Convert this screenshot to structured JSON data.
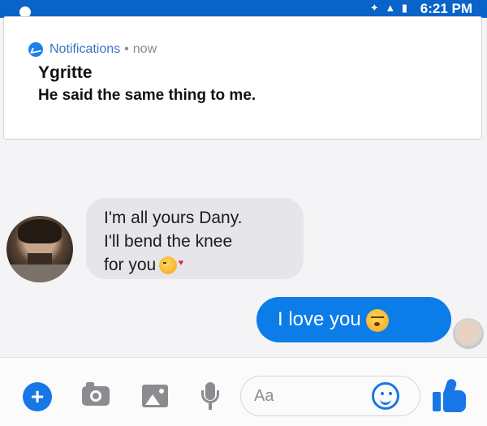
{
  "status_bar": {
    "system_icons": "✦ ▲ ▮",
    "time": "6:21 PM"
  },
  "notification": {
    "app_name": "Notifications",
    "separator": "•",
    "time": "now",
    "sender": "Ygritte",
    "message": "He said the same thing to me."
  },
  "conversation": {
    "incoming": {
      "lines": [
        "I'm all yours Dany.",
        "I'll bend the knee",
        "for you"
      ],
      "emoji": "kissing-face"
    },
    "outgoing": {
      "text": "I love you",
      "emoji": "smiling-face"
    }
  },
  "composer": {
    "placeholder": "Aa",
    "plus_label": "+"
  },
  "colors": {
    "accent": "#1877e6",
    "status_bar": "#0a63c8",
    "outgoing_bubble": "#0c7de8",
    "incoming_bubble": "#e6e6ea"
  }
}
